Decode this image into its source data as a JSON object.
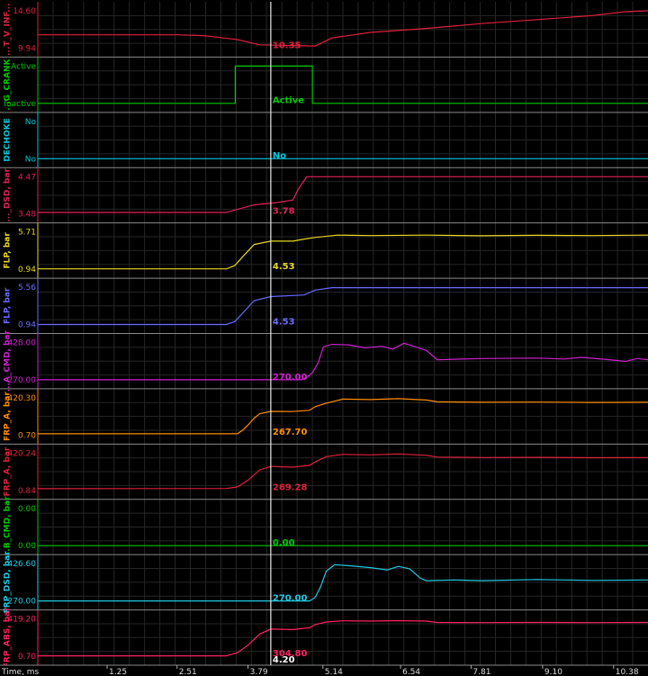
{
  "chart_data": {
    "type": "line",
    "time_axis": {
      "label": "Time, ms",
      "ticks": [
        "1.25",
        "2.51",
        "3.79",
        "5.14",
        "6.54",
        "7.81",
        "9.10",
        "10.38"
      ],
      "tick_values": [
        1.25,
        2.51,
        3.79,
        5.14,
        6.54,
        7.81,
        9.1,
        10.38
      ],
      "xlim": [
        0,
        11.0
      ]
    },
    "cursor": {
      "time": 4.2,
      "label": "4.20"
    },
    "grid": true,
    "panels": [
      {
        "name": "...T_V_INF...",
        "color": "#e0203a",
        "ytick_labels": [
          "14.60",
          "9.94"
        ],
        "ylim": [
          9.94,
          14.6
        ],
        "cursor_value": "10.35",
        "x": [
          0,
          2.5,
          3.0,
          3.6,
          4.0,
          5.0,
          5.3,
          6.0,
          7.0,
          8.0,
          9.0,
          10.0,
          10.6,
          11.0
        ],
        "y": [
          11.6,
          11.6,
          11.5,
          11.0,
          10.35,
          10.2,
          11.2,
          11.9,
          12.4,
          13.0,
          13.5,
          14.0,
          14.5,
          14.6
        ]
      },
      {
        "name": "...G_CRANK",
        "color": "#00c800",
        "ytick_labels": [
          "Active",
          "Inactive"
        ],
        "ylim": [
          0,
          1
        ],
        "cursor_value": "Active",
        "step": true,
        "x": [
          0,
          3.56,
          3.56,
          4.95,
          4.95,
          11.0
        ],
        "y": [
          0,
          0,
          1,
          1,
          0,
          0
        ]
      },
      {
        "name": "DECHOKE",
        "color": "#00c8d8",
        "ytick_labels": [
          "No",
          "No"
        ],
        "ylim": [
          0,
          1
        ],
        "cursor_value": "No",
        "x": [
          0,
          11.0
        ],
        "y": [
          0,
          0
        ]
      },
      {
        "name": "..._DSD, bar",
        "color": "#e0205a",
        "ytick_labels": [
          "4.47",
          "3.48"
        ],
        "ylim": [
          3.48,
          4.47
        ],
        "cursor_value": "3.78",
        "x": [
          0,
          3.4,
          3.6,
          3.9,
          4.3,
          4.6,
          4.7,
          4.85,
          11.0
        ],
        "y": [
          3.52,
          3.52,
          3.6,
          3.72,
          3.78,
          3.85,
          4.15,
          4.47,
          4.47
        ]
      },
      {
        "name": "FLP, bar",
        "color": "#e8d820",
        "ytick_labels": [
          "5.71",
          "0.94"
        ],
        "ylim": [
          0.94,
          5.71
        ],
        "cursor_value": "4.53",
        "x": [
          0,
          3.4,
          3.55,
          3.7,
          3.9,
          4.2,
          4.6,
          4.8,
          5.0,
          5.4,
          6.0,
          7.0,
          8.0,
          9.0,
          10.0,
          11.0
        ],
        "y": [
          0.98,
          0.98,
          1.4,
          2.6,
          4.1,
          4.53,
          4.53,
          4.8,
          5.0,
          5.3,
          5.25,
          5.3,
          5.22,
          5.28,
          5.25,
          5.3
        ]
      },
      {
        "name": "FLP, bar",
        "color": "#6a6aff",
        "ytick_labels": [
          "5.56",
          "0.94"
        ],
        "ylim": [
          0.94,
          5.56
        ],
        "cursor_value": "4.53",
        "x": [
          0,
          3.4,
          3.55,
          3.7,
          3.9,
          4.2,
          4.6,
          4.8,
          5.0,
          5.3,
          11.0
        ],
        "y": [
          0.94,
          0.94,
          1.3,
          2.4,
          3.9,
          4.4,
          4.53,
          4.6,
          5.2,
          5.5,
          5.5
        ]
      },
      {
        "name": "...A_CMD, bar",
        "color": "#d020d0",
        "ytick_labels": [
          "428.00",
          "270.00"
        ],
        "ylim": [
          270.0,
          428.0
        ],
        "cursor_value": "270.00",
        "step": true,
        "x": [
          0,
          4.75,
          4.85,
          4.95,
          5.05,
          5.15,
          5.3,
          5.6,
          5.9,
          6.2,
          6.4,
          6.6,
          6.8,
          7.0,
          7.2,
          8.0,
          9.0,
          9.5,
          9.8,
          10.3,
          10.6,
          10.8,
          11.0
        ],
        "y": [
          270,
          270,
          280,
          300,
          340,
          410,
          420,
          418,
          405,
          412,
          400,
          425,
          410,
          395,
          355,
          360,
          362,
          358,
          365,
          355,
          348,
          360,
          355
        ]
      },
      {
        "name": "FRP_A, bar",
        "color": "#ff8c00",
        "ytick_labels": [
          "420.30",
          "0.70"
        ],
        "ylim": [
          0.7,
          420.3
        ],
        "cursor_value": "267.70",
        "step": true,
        "x": [
          0,
          3.6,
          3.7,
          3.8,
          3.9,
          4.0,
          4.2,
          4.6,
          4.9,
          5.0,
          5.2,
          5.5,
          6.0,
          6.5,
          7.0,
          7.2,
          8.0,
          9.0,
          10.0,
          11.0
        ],
        "y": [
          15,
          15,
          60,
          120,
          190,
          240,
          267.7,
          265,
          280,
          320,
          360,
          405,
          400,
          410,
          395,
          375,
          370,
          372,
          368,
          370
        ]
      },
      {
        "name": "FRP_A, bar",
        "color": "#e0203a",
        "ytick_labels": [
          "420.24",
          "0.84"
        ],
        "ylim": [
          0.84,
          420.24
        ],
        "cursor_value": "269.28",
        "x": [
          0,
          3.4,
          3.6,
          3.8,
          4.0,
          4.2,
          4.6,
          4.9,
          5.0,
          5.2,
          5.5,
          6.0,
          6.5,
          7.0,
          7.2,
          8.0,
          9.0,
          10.0,
          11.0
        ],
        "y": [
          20,
          22,
          40,
          120,
          230,
          269.28,
          262,
          282,
          320,
          380,
          405,
          400,
          410,
          395,
          375,
          370,
          372,
          368,
          370
        ]
      },
      {
        "name": "...B_CMD, bar",
        "color": "#00c800",
        "ytick_labels": [
          "0.00",
          "0.00"
        ],
        "ylim": [
          0,
          1
        ],
        "cursor_value": "0.00",
        "x": [
          0,
          11.0
        ],
        "y": [
          0,
          0
        ]
      },
      {
        "name": "FRP_DSD, bar",
        "color": "#20c8e0",
        "ytick_labels": [
          "426.60",
          "270.00"
        ],
        "ylim": [
          270.0,
          426.6
        ],
        "cursor_value": "270.00",
        "x": [
          0,
          4.9,
          5.0,
          5.1,
          5.2,
          5.35,
          5.6,
          6.0,
          6.3,
          6.5,
          6.7,
          6.9,
          7.0,
          7.5,
          8.0,
          9.0,
          10.0,
          11.0
        ],
        "y": [
          270,
          270,
          285,
          330,
          395,
          422,
          418,
          410,
          400,
          415,
          405,
          365,
          355,
          358,
          355,
          360,
          356,
          358
        ]
      },
      {
        "name": "FRP_ABS, bar",
        "color": "#ff2060",
        "ytick_labels": [
          "419.20",
          "0.70"
        ],
        "ylim": [
          0.7,
          419.2
        ],
        "cursor_value": "304.80",
        "x": [
          0,
          3.4,
          3.6,
          3.8,
          4.0,
          4.2,
          4.6,
          4.9,
          5.0,
          5.2,
          5.5,
          6.0,
          6.5,
          7.0,
          7.2,
          8.0,
          9.0,
          10.0,
          11.0
        ],
        "y": [
          5,
          5,
          40,
          130,
          250,
          304.8,
          300,
          320,
          355,
          385,
          398,
          395,
          400,
          395,
          380,
          378,
          380,
          378,
          380
        ]
      }
    ]
  }
}
